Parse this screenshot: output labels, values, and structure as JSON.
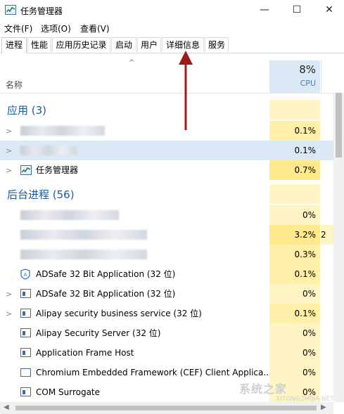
{
  "window": {
    "title": "任务管理器",
    "minimize": "—",
    "maximize": "☐",
    "close": "✕"
  },
  "menu": {
    "file": "文件(F)",
    "options": "选项(O)",
    "view": "查看(V)"
  },
  "tabs": [
    "进程",
    "性能",
    "应用历史记录",
    "启动",
    "用户",
    "详细信息",
    "服务"
  ],
  "header": {
    "sort_arrow": "^",
    "name_col": "名称",
    "cpu_pct": "8%",
    "cpu_label": "CPU"
  },
  "groups": {
    "apps": "应用 (3)",
    "background": "后台进程 (56)"
  },
  "rows": {
    "r1_cpu": "0.1%",
    "r2_cpu": "0.1%",
    "r3_name": "任务管理器",
    "r3_cpu": "0.7%",
    "b1_cpu": "0%",
    "b2_cpu": "3.2%",
    "b2_mem": "2",
    "b3_cpu": "0.3%",
    "b4_name": "ADSafe 32 Bit Application (32 位)",
    "b4_cpu": "0.1%",
    "b5_name": "ADSafe 32 Bit Application (32 位)",
    "b5_cpu": "0%",
    "b6_name": "Alipay security business service (32 位)",
    "b6_cpu": "0.1%",
    "b7_name": "Alipay Security Server (32 位)",
    "b7_cpu": "0%",
    "b8_name": "Application Frame Host",
    "b8_cpu": "0%",
    "b9_name": "Chromium Embedded Framework (CEF) Client Applica...",
    "b9_cpu": "0%",
    "b10_name": "COM Surrogate",
    "b10_cpu": "0%"
  },
  "watermark": {
    "text": "系统之家",
    "url": "XITONGZHIJIA.NET"
  },
  "colors": {
    "accent": "#1a5aa6",
    "selected": "#dbe9f7",
    "cpu_heat": "#ffefa8",
    "arrow": "#9b1b1b"
  }
}
